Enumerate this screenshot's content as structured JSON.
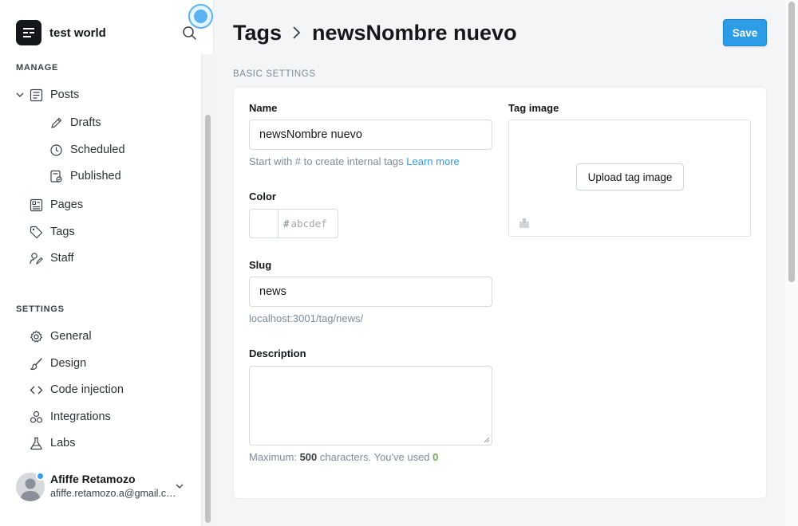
{
  "app": {
    "site_name": "test world"
  },
  "sidebar": {
    "manage_title": "MANAGE",
    "settings_title": "SETTINGS",
    "posts": "Posts",
    "drafts": "Drafts",
    "scheduled": "Scheduled",
    "published": "Published",
    "pages": "Pages",
    "tags": "Tags",
    "staff": "Staff",
    "general": "General",
    "design": "Design",
    "code_injection": "Code injection",
    "integrations": "Integrations",
    "labs": "Labs"
  },
  "user": {
    "name": "Afiffe Retamozo",
    "email": "afiffe.retamozo.a@gmail.com"
  },
  "header": {
    "breadcrumb_parent": "Tags",
    "title": "newsNombre nuevo",
    "save_label": "Save"
  },
  "form": {
    "section_title": "BASIC SETTINGS",
    "name_label": "Name",
    "name_value": "newsNombre nuevo",
    "name_hint": "Start with # to create internal tags",
    "learn_more": "Learn more",
    "color_label": "Color",
    "color_hash": "#",
    "color_placeholder": "abcdef",
    "slug_label": "Slug",
    "slug_value": "news",
    "slug_url": "localhost:3001/tag/news/",
    "description_label": "Description",
    "desc_hint_prefix": "Maximum:",
    "desc_max": "500",
    "desc_hint_mid": "characters. You've used",
    "desc_used": "0",
    "tag_image_label": "Tag image",
    "upload_label": "Upload tag image"
  },
  "colors": {
    "accent": "#2d9ce6",
    "green": "#6bb04d",
    "sidebar_bg": "#ffffff",
    "main_bg": "#f4f5f6"
  }
}
